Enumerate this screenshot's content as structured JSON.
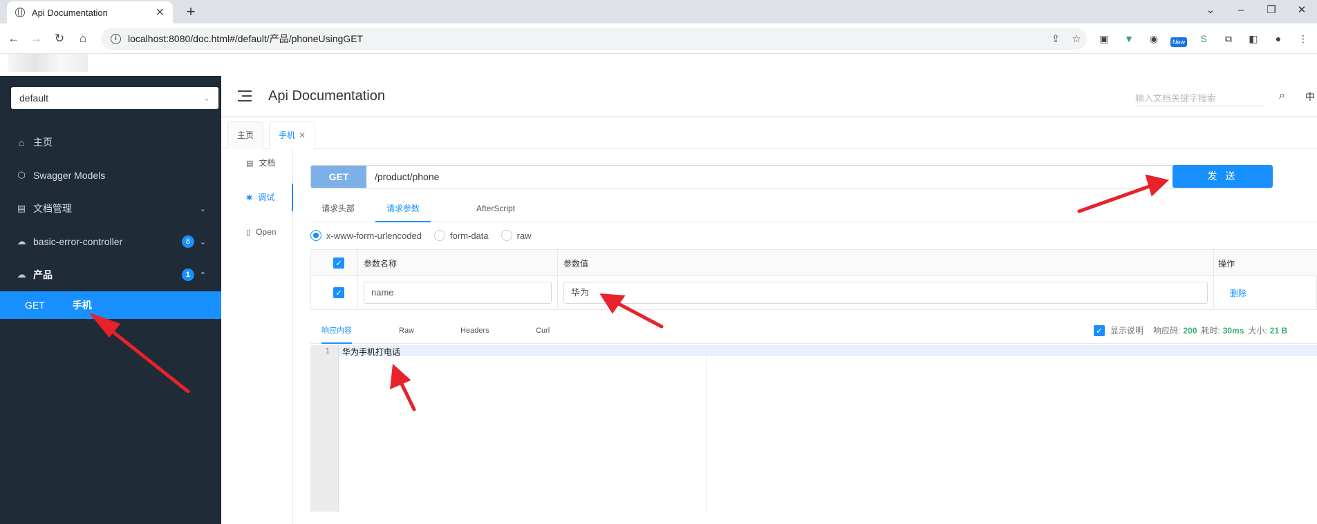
{
  "browser": {
    "tab_title": "Api Documentation",
    "tab_close": "✕",
    "new_tab": "+",
    "url": "localhost:8080/doc.html#/default/产品/phoneUsingGET"
  },
  "header": {
    "title": "Api Documentation",
    "search_placeholder": "输入文档关键字搜索",
    "lang": "中"
  },
  "sidebar": {
    "group_select": "default",
    "items": [
      {
        "label": "主页",
        "icon": "home-icon"
      },
      {
        "label": "Swagger Models",
        "icon": "cube-icon"
      },
      {
        "label": "文档管理",
        "icon": "document-icon",
        "arrow": "⌄"
      },
      {
        "label": "basic-error-controller",
        "icon": "cloud-icon",
        "badge": "8",
        "arrow": "⌄"
      },
      {
        "label": "产品",
        "icon": "cloud-icon",
        "badge": "1",
        "arrow": "⌃"
      }
    ],
    "active_api": {
      "method": "GET",
      "name": "手机"
    }
  },
  "doc_tabs": [
    {
      "label": "主页"
    },
    {
      "label": "手机",
      "close": "✕"
    }
  ],
  "subnav": [
    {
      "label": "文档",
      "icon": "doc-icon"
    },
    {
      "label": "调试",
      "icon": "bug-icon"
    },
    {
      "label": "Open",
      "icon": "file-icon"
    }
  ],
  "request": {
    "method": "GET",
    "path": "/product/phone",
    "send_label": "发 送"
  },
  "param_tabs": [
    "请求头部",
    "请求参数",
    "AfterScript"
  ],
  "body_types": [
    "x-www-form-urlencoded",
    "form-data",
    "raw"
  ],
  "param_table": {
    "headers": [
      "参数名称",
      "参数值",
      "操作"
    ],
    "rows": [
      {
        "name": "name",
        "value": "华为",
        "action": "删除"
      }
    ]
  },
  "response_tabs": [
    "响应内容",
    "Raw",
    "Headers",
    "Curl"
  ],
  "response_meta": {
    "show_desc": "显示说明",
    "code_label": "响应码:",
    "code": "200",
    "time_label": "耗时:",
    "time": "30ms",
    "size_label": "大小:",
    "size": "21 B"
  },
  "response_body": {
    "line_no": "1",
    "text": "华为手机打电话"
  },
  "colors": {
    "accent": "#1890ff",
    "sidebar_bg": "#1f2b37",
    "annotation_arrow": "#e8222a",
    "success": "#32b36e"
  }
}
